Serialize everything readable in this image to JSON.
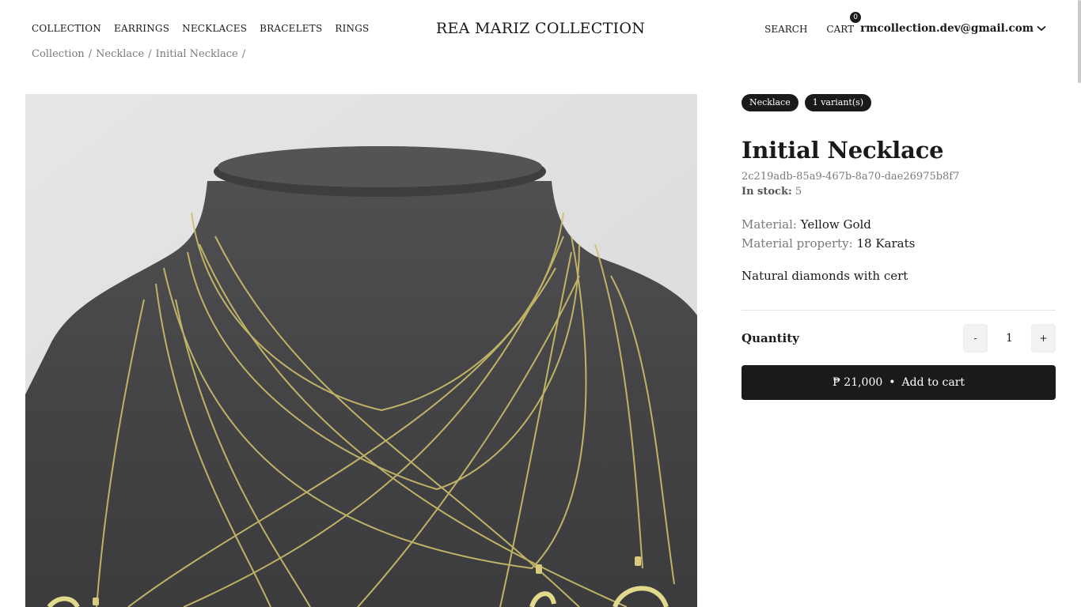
{
  "nav": {
    "items": [
      "COLLECTION",
      "EARRINGS",
      "NECKLACES",
      "BRACELETS",
      "RINGS"
    ]
  },
  "brand": "REA MARIZ COLLECTION",
  "header_right": {
    "search": "SEARCH",
    "cart": "CART",
    "cart_count": "0",
    "account_email": "rmcollection.dev@gmail.com"
  },
  "breadcrumb": [
    "Collection",
    "/",
    "Necklace",
    "/",
    "Initial Necklace",
    "/"
  ],
  "product": {
    "tags": [
      "Necklace",
      "1 variant(s)"
    ],
    "title": "Initial Necklace",
    "id": "2c219adb-85a9-467b-8a70-dae26975b8f7",
    "stock_label": "In stock:",
    "stock_value": "5",
    "material_label": "Material:",
    "material_value": "Yellow Gold",
    "property_label": "Material property:",
    "property_value": "18 Karats",
    "description": "Natural diamonds with cert",
    "quantity_label": "Quantity",
    "minus": "-",
    "quantity": "1",
    "plus": "+",
    "price": "₱ 21,000",
    "separator": "•",
    "add_to_cart": "Add to cart"
  },
  "colors": {
    "accent": "#1a1a1a",
    "muted": "#7a7a7a",
    "image_bg": "#e8e8e8",
    "bust": "#4a4a4c",
    "gold": "#cdbf6a"
  }
}
